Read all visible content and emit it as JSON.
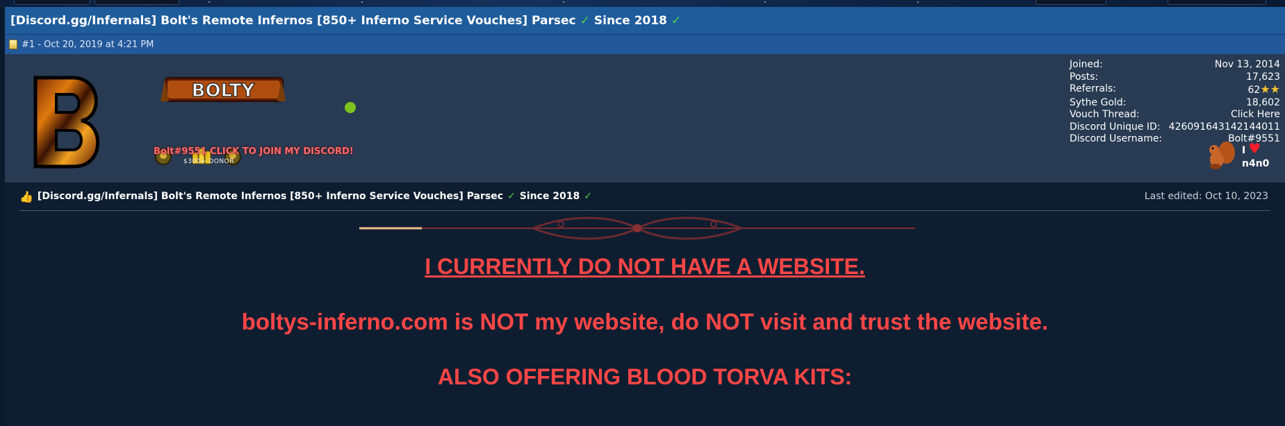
{
  "thread": {
    "title_main": "[Discord.gg/Infernals] Bolt's Remote Infernos [850+ Inferno Service Vouches] Parsec",
    "title_since": "Since 2018",
    "check_glyph": "✓"
  },
  "post_meta": {
    "number": "#1",
    "separator": " - ",
    "date": "Oct 20, 2019 at 4:21 PM"
  },
  "banner": {
    "logo_text": "BOLTY",
    "discord_text": "Bolt#9551 CLICK TO JOIN MY DISCORD!",
    "donor_text": "$300+ DONOR"
  },
  "stats": {
    "rows": [
      {
        "label": "Joined:",
        "value": "Nov 13, 2014"
      },
      {
        "label": "Posts:",
        "value": "17,623"
      },
      {
        "label": "Referrals:",
        "value": "62"
      },
      {
        "label": "Sythe Gold:",
        "value": "18,602"
      },
      {
        "label": "Vouch Thread:",
        "value": "Click Here"
      },
      {
        "label": "Discord Unique ID:",
        "value": "426091643142144011"
      },
      {
        "label": "Discord Username:",
        "value": "Bolt#9551"
      }
    ],
    "star_glyphs": "★★"
  },
  "badges": {
    "heart_text": "I",
    "heart_glyph": "♥",
    "name_text": "n4n0"
  },
  "post": {
    "thumb_icon": "👍",
    "title_main": "[Discord.gg/Infernals] Bolt's Remote Infernos [850+ Inferno Service Vouches] Parsec",
    "title_since": "Since 2018",
    "last_edited": "Last edited: Oct 10, 2023",
    "line1": "I CURRENTLY DO NOT HAVE A WEBSITE.",
    "line2": "boltys-inferno.com is NOT my website, do NOT visit and trust the website.",
    "line3": "ALSO OFFERING BLOOD TORVA KITS:"
  },
  "colors": {
    "title_bar": "#1f5c9b",
    "meta_bar": "#23589a",
    "user_bar": "#283b52",
    "body_bg": "#0f1d30",
    "alert_red": "#ff4646",
    "check_green": "#4fd24a",
    "online_green": "#7ec41e"
  }
}
